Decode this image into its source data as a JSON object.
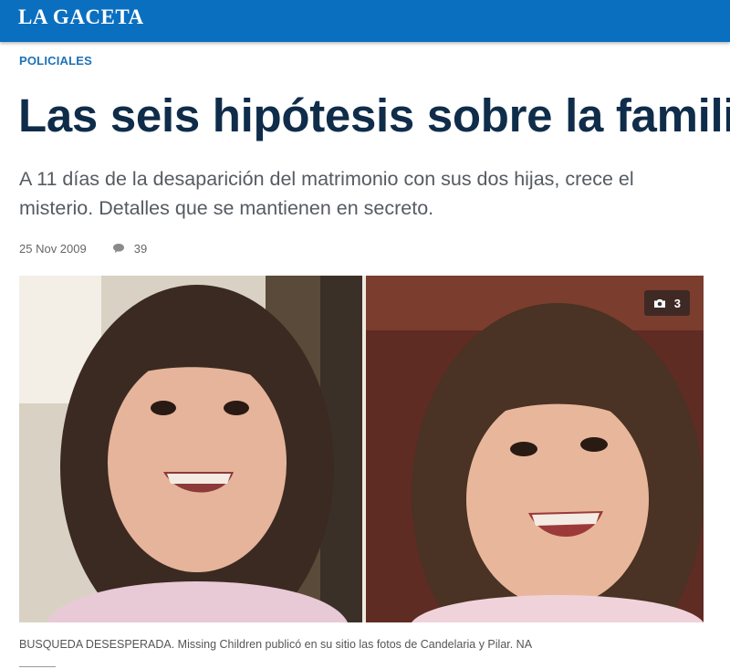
{
  "header": {
    "logo": "LA GACETA",
    "brand_color": "#0b6fc0"
  },
  "article": {
    "section": "POLICIALES",
    "title": "Las seis hipótesis sobre la familia Pomar",
    "subtitle": "A 11 días de la desaparición del matrimonio con sus dos hijas, crece el misterio. Detalles que se mantienen en secreto.",
    "date": "25 Nov 2009",
    "comments_count": "39",
    "comments_icon": "comment-icon",
    "photo": {
      "gallery_count": "3",
      "gallery_icon": "camera-icon",
      "caption": "BUSQUEDA DESESPERADA. Missing Children publicó en su sitio las fotos de Candelaria y Pilar. NA"
    }
  }
}
